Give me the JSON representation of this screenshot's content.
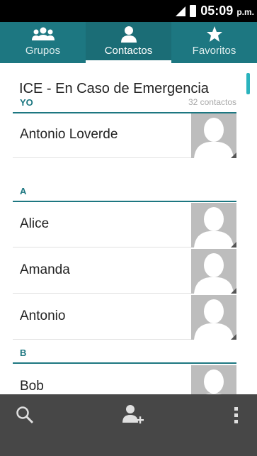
{
  "status_bar": {
    "time": "05:09",
    "ampm": "p.m."
  },
  "tabs": [
    {
      "label": "Grupos",
      "icon": "group-icon"
    },
    {
      "label": "Contactos",
      "icon": "person-icon"
    },
    {
      "label": "Favoritos",
      "icon": "star-icon"
    }
  ],
  "ice_label": "ICE - En Caso de Emergencia",
  "sections": [
    {
      "header": "YO",
      "count": "32 contactos"
    },
    {
      "header": "A"
    },
    {
      "header": "B"
    }
  ],
  "contacts": [
    {
      "name": "Antonio Loverde"
    },
    {
      "name": "Alice"
    },
    {
      "name": "Amanda"
    },
    {
      "name": "Antonio"
    },
    {
      "name": "Bob"
    }
  ],
  "bottom_bar": {
    "search_icon": "search-icon",
    "add_icon": "add-contact-icon",
    "menu_icon": "overflow-menu-icon"
  },
  "colors": {
    "accent": "#1d7781",
    "scroll": "#2ab3bd",
    "bottom_bar": "#474747"
  }
}
